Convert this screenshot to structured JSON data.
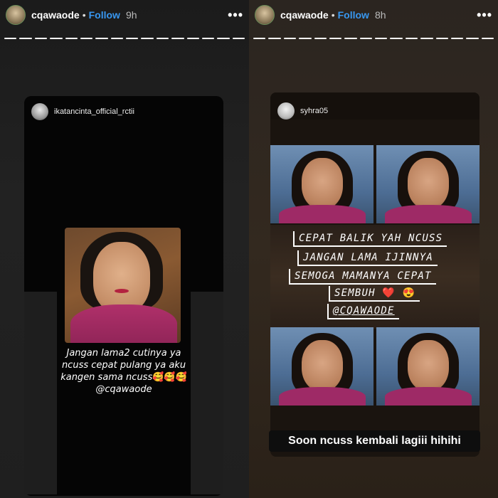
{
  "stories": [
    {
      "username": "cqawaode",
      "follow_label": "Follow",
      "time": "9h",
      "more": "•••",
      "card": {
        "username": "ikatancinta_official_rctii",
        "caption_lines": [
          "Jangan lama2 cutinya ya",
          "ncuss cepat pulang ya aku",
          "kangen sama ncuss"
        ],
        "emoji": "🥰🥰🥰",
        "mention": "@cqawaode"
      }
    },
    {
      "username": "cqawaode",
      "follow_label": "Follow",
      "time": "8h",
      "more": "•••",
      "card": {
        "username": "syhra05",
        "tags": [
          "CEPAT BALIK YAH NCUSS",
          "JANGAN LAMA IJINNYA",
          "SEMOGA MAMANYA CEPAT",
          "SEMBUH",
          "@CQAWAODE"
        ],
        "emoji_heart": "❤️",
        "emoji_smile": "😍",
        "caption": "Soon ncuss kembali lagiii hihihi"
      }
    }
  ],
  "colors": {
    "follow": "#3897f0",
    "dress": "#9e2a66",
    "background": "#1e1e1e"
  },
  "icons": [
    "avatar-icon",
    "more-options-icon",
    "progress-bar"
  ]
}
